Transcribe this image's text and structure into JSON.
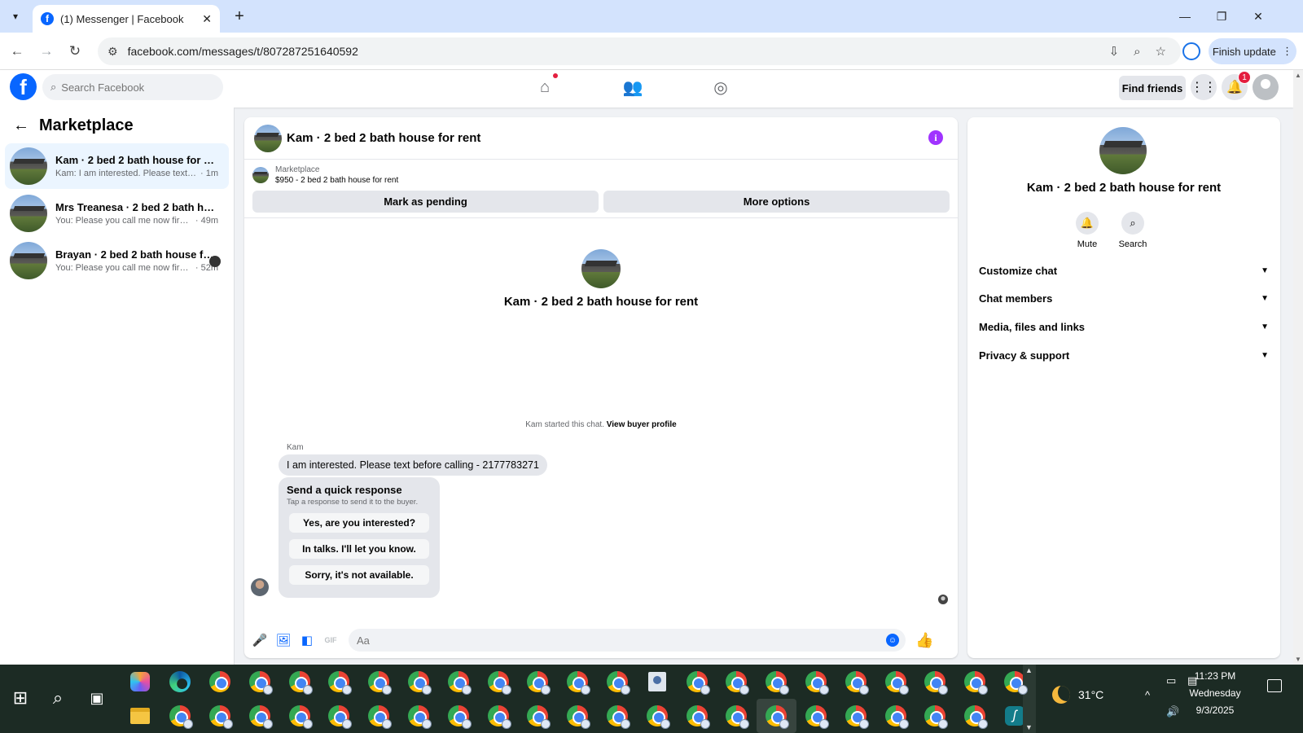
{
  "browser": {
    "tab_title": "(1) Messenger | Facebook",
    "url": "facebook.com/messages/t/807287251640592",
    "finish_update": "Finish update"
  },
  "fb": {
    "search_placeholder": "Search Facebook",
    "find_friends": "Find friends",
    "notification_count": "1",
    "brand_color": "#0866ff"
  },
  "sidebar": {
    "title": "Marketplace",
    "conversations": [
      {
        "name": "Kam · 2 bed 2 bath house for rent",
        "snippet": "Kam: I am interested. Please text bef...",
        "time": "· 1m",
        "active": true
      },
      {
        "name": "Mrs Treanesa · 2 bed 2 bath house...",
        "snippet": "You: Please you call me now first. W...",
        "time": "· 49m",
        "active": false
      },
      {
        "name": "Brayan · 2 bed 2 bath house for ...",
        "snippet": "You: Please you call me now first. ...",
        "time": "· 52m",
        "active": false
      }
    ]
  },
  "chat": {
    "title": "Kam · 2 bed 2 bath house for rent",
    "listing_label": "Marketplace",
    "listing_price": "$950 - 2 bed 2 bath house for rent",
    "mark_pending": "Mark as pending",
    "more_options": "More options",
    "intro_name": "Kam · 2 bed 2 bath house for rent",
    "started_text": "Kam started this chat.",
    "view_buyer": "View buyer profile",
    "sender": "Kam",
    "message": "I am interested. Please text before calling - 2177783271",
    "quick_title": "Send a quick response",
    "quick_sub": "Tap a response to send it to the buyer.",
    "quick_responses": [
      "Yes, are you interested?",
      "In talks. I'll let you know.",
      "Sorry, it's not available."
    ],
    "composer_placeholder": "Aa",
    "gif_label": "GIF"
  },
  "info_panel": {
    "name": "Kam · 2 bed 2 bath house for rent",
    "mute": "Mute",
    "search": "Search",
    "sections": [
      "Customize chat",
      "Chat members",
      "Media, files and links",
      "Privacy & support"
    ]
  },
  "taskbar": {
    "temperature": "31°C",
    "time": "11:23 PM",
    "day": "Wednesday",
    "date": "9/3/2025"
  }
}
